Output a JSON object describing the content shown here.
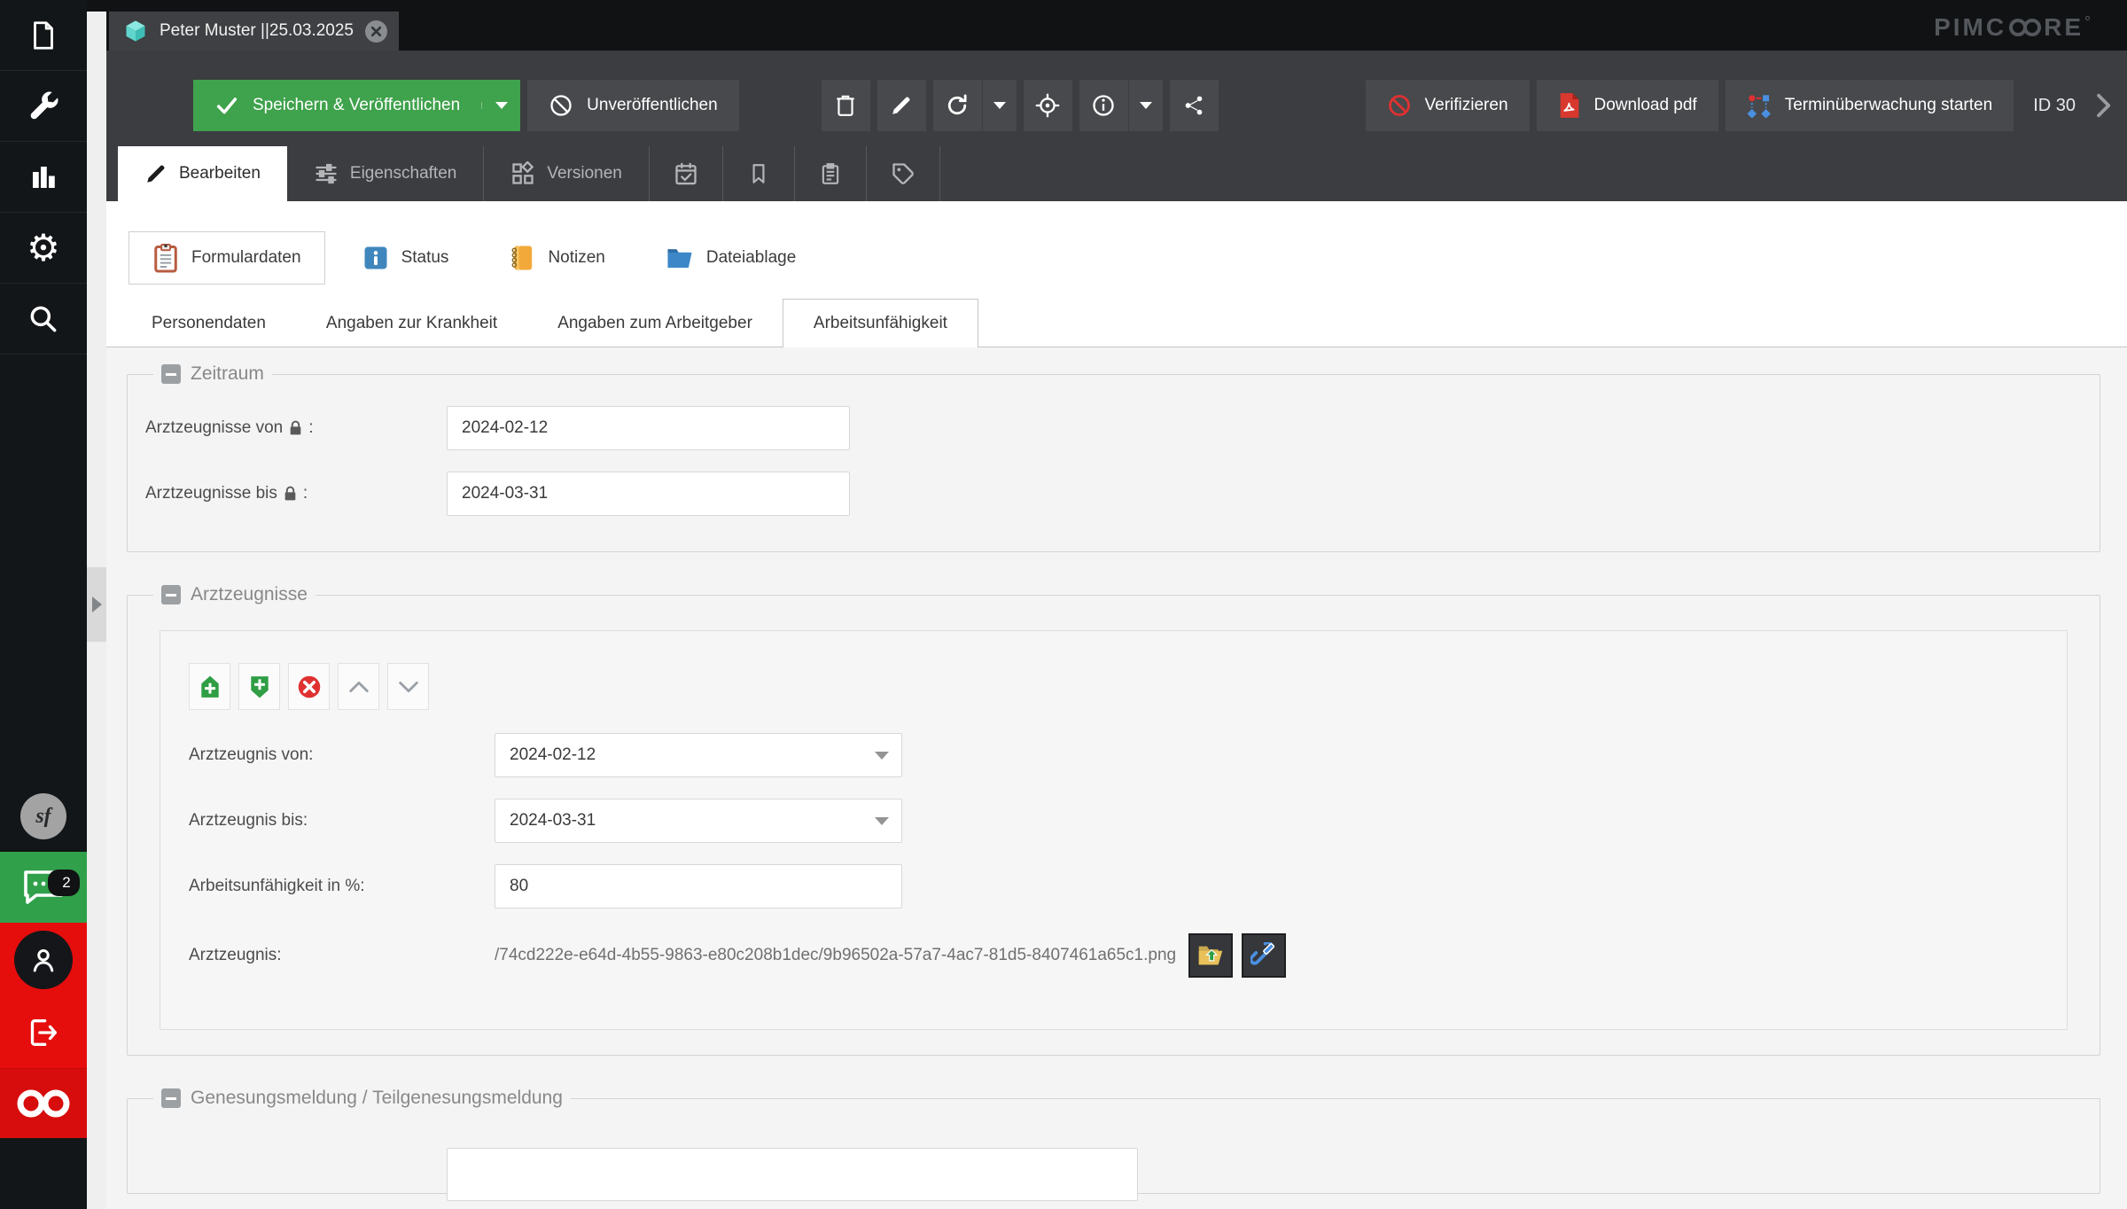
{
  "brand": {
    "left": "PIMC",
    "right": "RE"
  },
  "sidebar": {
    "symfony_label": "sf",
    "chat_badge": "2"
  },
  "doc_tab": {
    "title": "Peter Muster ||25.03.2025"
  },
  "toolbar": {
    "save": "Speichern & Veröffentlichen",
    "unpublish": "Unveröffentlichen",
    "verify": "Verifizieren",
    "download_pdf": "Download pdf",
    "monitoring": "Terminüberwachung starten",
    "id_label": "ID 30"
  },
  "tabs": {
    "row2": [
      {
        "label": "Bearbeiten"
      },
      {
        "label": "Eigenschaften"
      },
      {
        "label": "Versionen"
      }
    ],
    "row3": [
      {
        "label": "Formulardaten"
      },
      {
        "label": "Status"
      },
      {
        "label": "Notizen"
      },
      {
        "label": "Dateiablage"
      }
    ],
    "row4": [
      {
        "label": "Personendaten"
      },
      {
        "label": "Angaben zur Krankheit"
      },
      {
        "label": "Angaben zum Arbeitgeber"
      },
      {
        "label": "Arbeitsunfähigkeit"
      }
    ]
  },
  "zeitraum": {
    "legend": "Zeitraum",
    "fields": [
      {
        "label": "Arztzeugnisse von",
        "colon": ":",
        "value": "2024-02-12"
      },
      {
        "label": "Arztzeugnisse bis",
        "colon": ":",
        "value": "2024-03-31"
      }
    ]
  },
  "arztzeugnisse": {
    "legend": "Arztzeugnisse",
    "fields": [
      {
        "label": "Arztzeugnis von:",
        "value": "2024-02-12"
      },
      {
        "label": "Arztzeugnis bis:",
        "value": "2024-03-31"
      },
      {
        "label": "Arbeitsunfähigkeit in %:",
        "value": "80"
      },
      {
        "label": "Arztzeugnis:",
        "value": "/74cd222e-e64d-4b55-9863-e80c208b1dec/9b96502a-57a7-4ac7-81d5-8407461a65c1.png"
      }
    ]
  },
  "genesung": {
    "legend": "Genesungsmeldung / Teilgenesungsmeldung"
  },
  "colors": {
    "accent_green": "#3fa24c",
    "accent_red": "#e03131",
    "sidebar_red": "#e60d0d",
    "status_blue": "#3f86bc",
    "notes_orange": "#f3a93a",
    "folder_blue": "#3d87c8",
    "cube_teal": "#52cec5"
  }
}
